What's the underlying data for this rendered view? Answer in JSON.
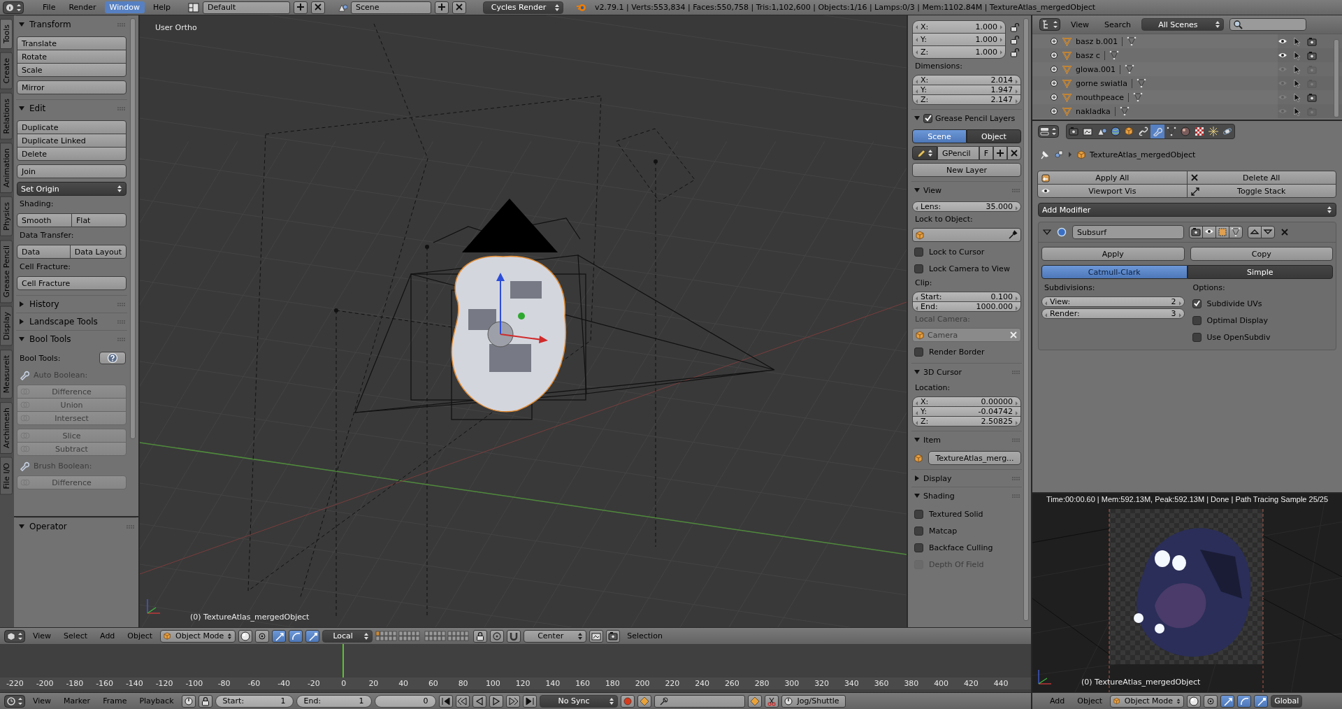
{
  "info_header": {
    "menus": [
      {
        "label": "File",
        "selected": false
      },
      {
        "label": "Render",
        "selected": false
      },
      {
        "label": "Window",
        "selected": true
      },
      {
        "label": "Help",
        "selected": false
      }
    ],
    "layout": "Default",
    "scene": "Scene",
    "engine": "Cycles Render",
    "stats": "v2.79.1 | Verts:553,834 | Faces:550,758 | Tris:1,102,600 | Objects:1/16 | Lamps:0/3 | Mem:1102.84M | TextureAtlas_mergedObject"
  },
  "tool_tabs": [
    {
      "label": "Tools",
      "selected": true
    },
    {
      "label": "Create",
      "selected": false
    },
    {
      "label": "Relations",
      "selected": false
    },
    {
      "label": "Animation",
      "selected": false
    },
    {
      "label": "Physics",
      "selected": false
    },
    {
      "label": "Grease Pencil",
      "selected": false
    },
    {
      "label": "Display",
      "selected": false
    },
    {
      "label": "Measureit",
      "selected": false
    },
    {
      "label": "Archimesh",
      "selected": false
    },
    {
      "label": "File I/O",
      "selected": false
    }
  ],
  "tool_shelf": {
    "panels": [
      {
        "title": "Transform",
        "expanded": true,
        "items": [
          {
            "kind": "column",
            "buttons": [
              "Translate",
              "Rotate",
              "Scale"
            ]
          },
          {
            "kind": "column",
            "buttons": [
              "Mirror"
            ]
          }
        ]
      },
      {
        "title": "Edit",
        "expanded": true,
        "items": [
          {
            "kind": "column",
            "buttons": [
              "Duplicate",
              "Duplicate Linked",
              "Delete"
            ]
          },
          {
            "kind": "column",
            "buttons": [
              "Join"
            ]
          },
          {
            "kind": "dropdown",
            "value": "Set Origin"
          },
          {
            "kind": "label",
            "text": "Shading:"
          },
          {
            "kind": "row",
            "buttons": [
              "Smooth",
              "Flat"
            ]
          },
          {
            "kind": "label",
            "text": "Data Transfer:"
          },
          {
            "kind": "row",
            "buttons": [
              "Data",
              "Data Layout"
            ]
          },
          {
            "kind": "label",
            "text": "Cell Fracture:"
          },
          {
            "kind": "column",
            "buttons": [
              "Cell Fracture"
            ]
          }
        ]
      },
      {
        "title": "History",
        "expanded": false
      },
      {
        "title": "Landscape Tools",
        "expanded": false
      },
      {
        "title": "Bool Tools",
        "expanded": true,
        "items": [
          {
            "kind": "help_row",
            "text": "Bool Tools:"
          },
          {
            "kind": "icon_label",
            "text": "Auto Boolean:",
            "disabled": true
          },
          {
            "kind": "icon_column",
            "buttons": [
              "Difference",
              "Union",
              "Intersect"
            ],
            "disabled": true
          },
          {
            "kind": "icon_column",
            "buttons": [
              "Slice",
              "Subtract"
            ],
            "disabled": true
          },
          {
            "kind": "icon_label",
            "text": "Brush Boolean:",
            "disabled": true
          },
          {
            "kind": "icon_column",
            "buttons": [
              "Difference"
            ],
            "disabled": true
          }
        ]
      }
    ],
    "operator": {
      "title": "Operator",
      "expanded": true
    }
  },
  "viewport": {
    "view_name": "User Ortho",
    "object_label": "(0) TextureAtlas_mergedObject"
  },
  "view3d_header": {
    "menus": [
      "View",
      "Select",
      "Add",
      "Object"
    ],
    "mode": "Object Mode",
    "orientation": "Local",
    "snap_target": "Center",
    "status_text": "Selection"
  },
  "n_panel": {
    "panels": [
      {
        "items": [
          {
            "kind": "vector",
            "fields": [
              {
                "label": "X:",
                "value": "1.000",
                "locked": false
              },
              {
                "label": "Y:",
                "value": "1.000",
                "locked": false
              },
              {
                "label": "Z:",
                "value": "1.000",
                "locked": false
              }
            ]
          },
          {
            "kind": "label",
            "text": "Dimensions:"
          },
          {
            "kind": "vector",
            "fields": [
              {
                "label": "X:",
                "value": "2.014"
              },
              {
                "label": "Y:",
                "value": "1.947"
              },
              {
                "label": "Z:",
                "value": "2.147"
              }
            ]
          }
        ]
      },
      {
        "title": "Grease Pencil Layers",
        "expanded": true,
        "checked": true,
        "items": [
          {
            "kind": "tabs",
            "tabs": [
              {
                "label": "Scene",
                "selected": true
              },
              {
                "label": "Object",
                "selected": false
              }
            ]
          },
          {
            "kind": "gpencil_row",
            "name": "GPencil",
            "flag": "F"
          },
          {
            "kind": "button",
            "label": "New Layer"
          }
        ]
      },
      {
        "title": "View",
        "expanded": true,
        "items": [
          {
            "kind": "field",
            "label": "Lens:",
            "value": "35.000"
          },
          {
            "kind": "label",
            "text": "Lock to Object:"
          },
          {
            "kind": "object_picker"
          },
          {
            "kind": "checkbox",
            "label": "Lock to Cursor",
            "checked": false
          },
          {
            "kind": "checkbox",
            "label": "Lock Camera to View",
            "checked": false
          },
          {
            "kind": "label",
            "text": "Clip:"
          },
          {
            "kind": "vector",
            "fields": [
              {
                "label": "Start:",
                "value": "0.100"
              },
              {
                "label": "End:",
                "value": "1000.000"
              }
            ]
          },
          {
            "kind": "label",
            "text": "Local Camera:",
            "disabled": true
          },
          {
            "kind": "object_field",
            "value": "Camera",
            "disabled": true
          },
          {
            "kind": "checkbox",
            "label": "Render Border",
            "checked": false
          }
        ]
      },
      {
        "title": "3D Cursor",
        "expanded": true,
        "items": [
          {
            "kind": "label",
            "text": "Location:"
          },
          {
            "kind": "vector",
            "fields": [
              {
                "label": "X:",
                "value": "0.00000"
              },
              {
                "label": "Y:",
                "value": "-0.04742"
              },
              {
                "label": "Z:",
                "value": "2.50825"
              }
            ]
          }
        ]
      },
      {
        "title": "Item",
        "expanded": true,
        "items": [
          {
            "kind": "item_name",
            "value": "TextureAtlas_merg..."
          }
        ]
      },
      {
        "title": "Display",
        "expanded": false
      },
      {
        "title": "Shading",
        "expanded": true,
        "items": [
          {
            "kind": "checkbox",
            "label": "Textured Solid",
            "checked": false
          },
          {
            "kind": "checkbox",
            "label": "Matcap",
            "checked": false
          },
          {
            "kind": "checkbox",
            "label": "Backface Culling",
            "checked": false
          },
          {
            "kind": "checkbox",
            "label": "Depth Of Field",
            "checked": false,
            "disabled": true
          }
        ]
      }
    ]
  },
  "timeline": {
    "playhead": {
      "level": 0.333
    },
    "ticks": [
      "-220",
      "-200",
      "-180",
      "-160",
      "-140",
      "-120",
      "-100",
      "-80",
      "-60",
      "-40",
      "-20",
      "0",
      "20",
      "40",
      "60",
      "80",
      "100",
      "120",
      "140",
      "160",
      "180",
      "200",
      "220",
      "240",
      "260",
      "280",
      "300",
      "320",
      "340",
      "360",
      "380",
      "400",
      "420",
      "440"
    ],
    "header": {
      "menus": [
        "View",
        "Marker",
        "Frame",
        "Playback"
      ],
      "start": {
        "label": "Start:",
        "value": "1"
      },
      "end": {
        "label": "End:",
        "value": "1"
      },
      "frame": "0",
      "sync": "No Sync",
      "jog": "Jog/Shuttle"
    }
  },
  "outliner": {
    "menus": [
      "View",
      "Search"
    ],
    "filter": "All Scenes",
    "rows": [
      {
        "name": "basz b.001",
        "visible": true,
        "renderable": true
      },
      {
        "name": "basz c",
        "visible": true,
        "renderable": true
      },
      {
        "name": "glowa.001",
        "visible": false,
        "renderable": false
      },
      {
        "name": "gorne swiatla",
        "visible": false,
        "renderable": false
      },
      {
        "name": "mouthpeace",
        "visible": false,
        "renderable": true
      },
      {
        "name": "nakladka",
        "visible": false,
        "renderable": false
      }
    ]
  },
  "properties": {
    "tabs": [
      {
        "selected": false
      },
      {
        "selected": false
      },
      {
        "selected": false
      },
      {
        "selected": false
      },
      {
        "selected": false
      },
      {
        "selected": false
      },
      {
        "selected": true
      },
      {
        "selected": false
      },
      {
        "selected": false
      },
      {
        "selected": false
      },
      {
        "selected": false
      },
      {
        "selected": false
      }
    ],
    "breadcrumb": "TextureAtlas_mergedObject",
    "actions": [
      "Apply All",
      "Delete All",
      "Viewport Vis",
      "Toggle Stack"
    ],
    "add_modifier": "Add Modifier",
    "modifier": {
      "name": "Subsurf",
      "expanded": true,
      "buttons": [
        "Apply",
        "Copy"
      ],
      "types": [
        {
          "label": "Catmull-Clark",
          "selected": true
        },
        {
          "label": "Simple",
          "selected": false
        }
      ],
      "subdivisions_label": "Subdivisions:",
      "levels": [
        {
          "label": "View:",
          "value": "2"
        },
        {
          "label": "Render:",
          "value": "3"
        }
      ],
      "options_label": "Options:",
      "options": [
        {
          "label": "Subdivide UVs",
          "checked": true
        },
        {
          "label": "Optimal Display",
          "checked": false
        },
        {
          "label": "Use OpenSubdiv",
          "checked": false
        }
      ]
    }
  },
  "render_view": {
    "status": "Time:00:00.60 | Mem:592.13M, Peak:592.13M | Done | Path Tracing Sample 25/25",
    "object_label": "(0) TextureAtlas_mergedObject",
    "header": {
      "menus": [
        "Add",
        "Object"
      ],
      "mode": "Object Mode",
      "orientation": "Global"
    }
  }
}
